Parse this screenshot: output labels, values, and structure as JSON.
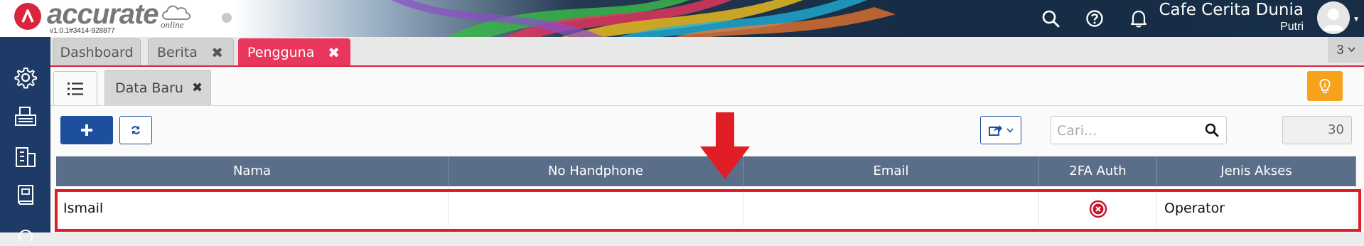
{
  "app": {
    "logo_text": "accurate",
    "logo_sub": "online",
    "version": "v1.0.1#3414-928877"
  },
  "header": {
    "company": "Cafe Cerita Dunia",
    "user": "Putri",
    "icons": [
      "search-icon",
      "help-icon",
      "bell-icon",
      "avatar"
    ]
  },
  "sidebar": {
    "items": [
      "gear-icon",
      "fax-icon",
      "building-icon",
      "book-icon"
    ]
  },
  "tabs": [
    {
      "label": "Dashboard",
      "closable": false
    },
    {
      "label": "Berita",
      "closable": true
    },
    {
      "label": "Pengguna",
      "closable": true,
      "active": true
    }
  ],
  "tab_count": "3",
  "subtabs": {
    "list_icon": "list-icon",
    "new_label": "Data Baru"
  },
  "toolbar": {
    "add_icon": "plus-icon",
    "refresh_icon": "refresh-icon",
    "export_icon": "export-icon",
    "search_placeholder": "Cari...",
    "page_size": "30"
  },
  "table": {
    "columns": [
      "Nama",
      "No Handphone",
      "Email",
      "2FA Auth",
      "Jenis Akses"
    ],
    "rows": [
      {
        "nama": "Ismail",
        "no_handphone": "",
        "email": "",
        "twofa": "disabled",
        "jenis_akses": "Operator"
      }
    ]
  },
  "colors": {
    "brand_red": "#d9263c",
    "active_tab": "#e8365d",
    "sidebar": "#1e3a66",
    "primary": "#1d4f9c",
    "grid_header": "#5a6e89",
    "annotation": "#e11e26",
    "bulb": "#f7a21b"
  }
}
